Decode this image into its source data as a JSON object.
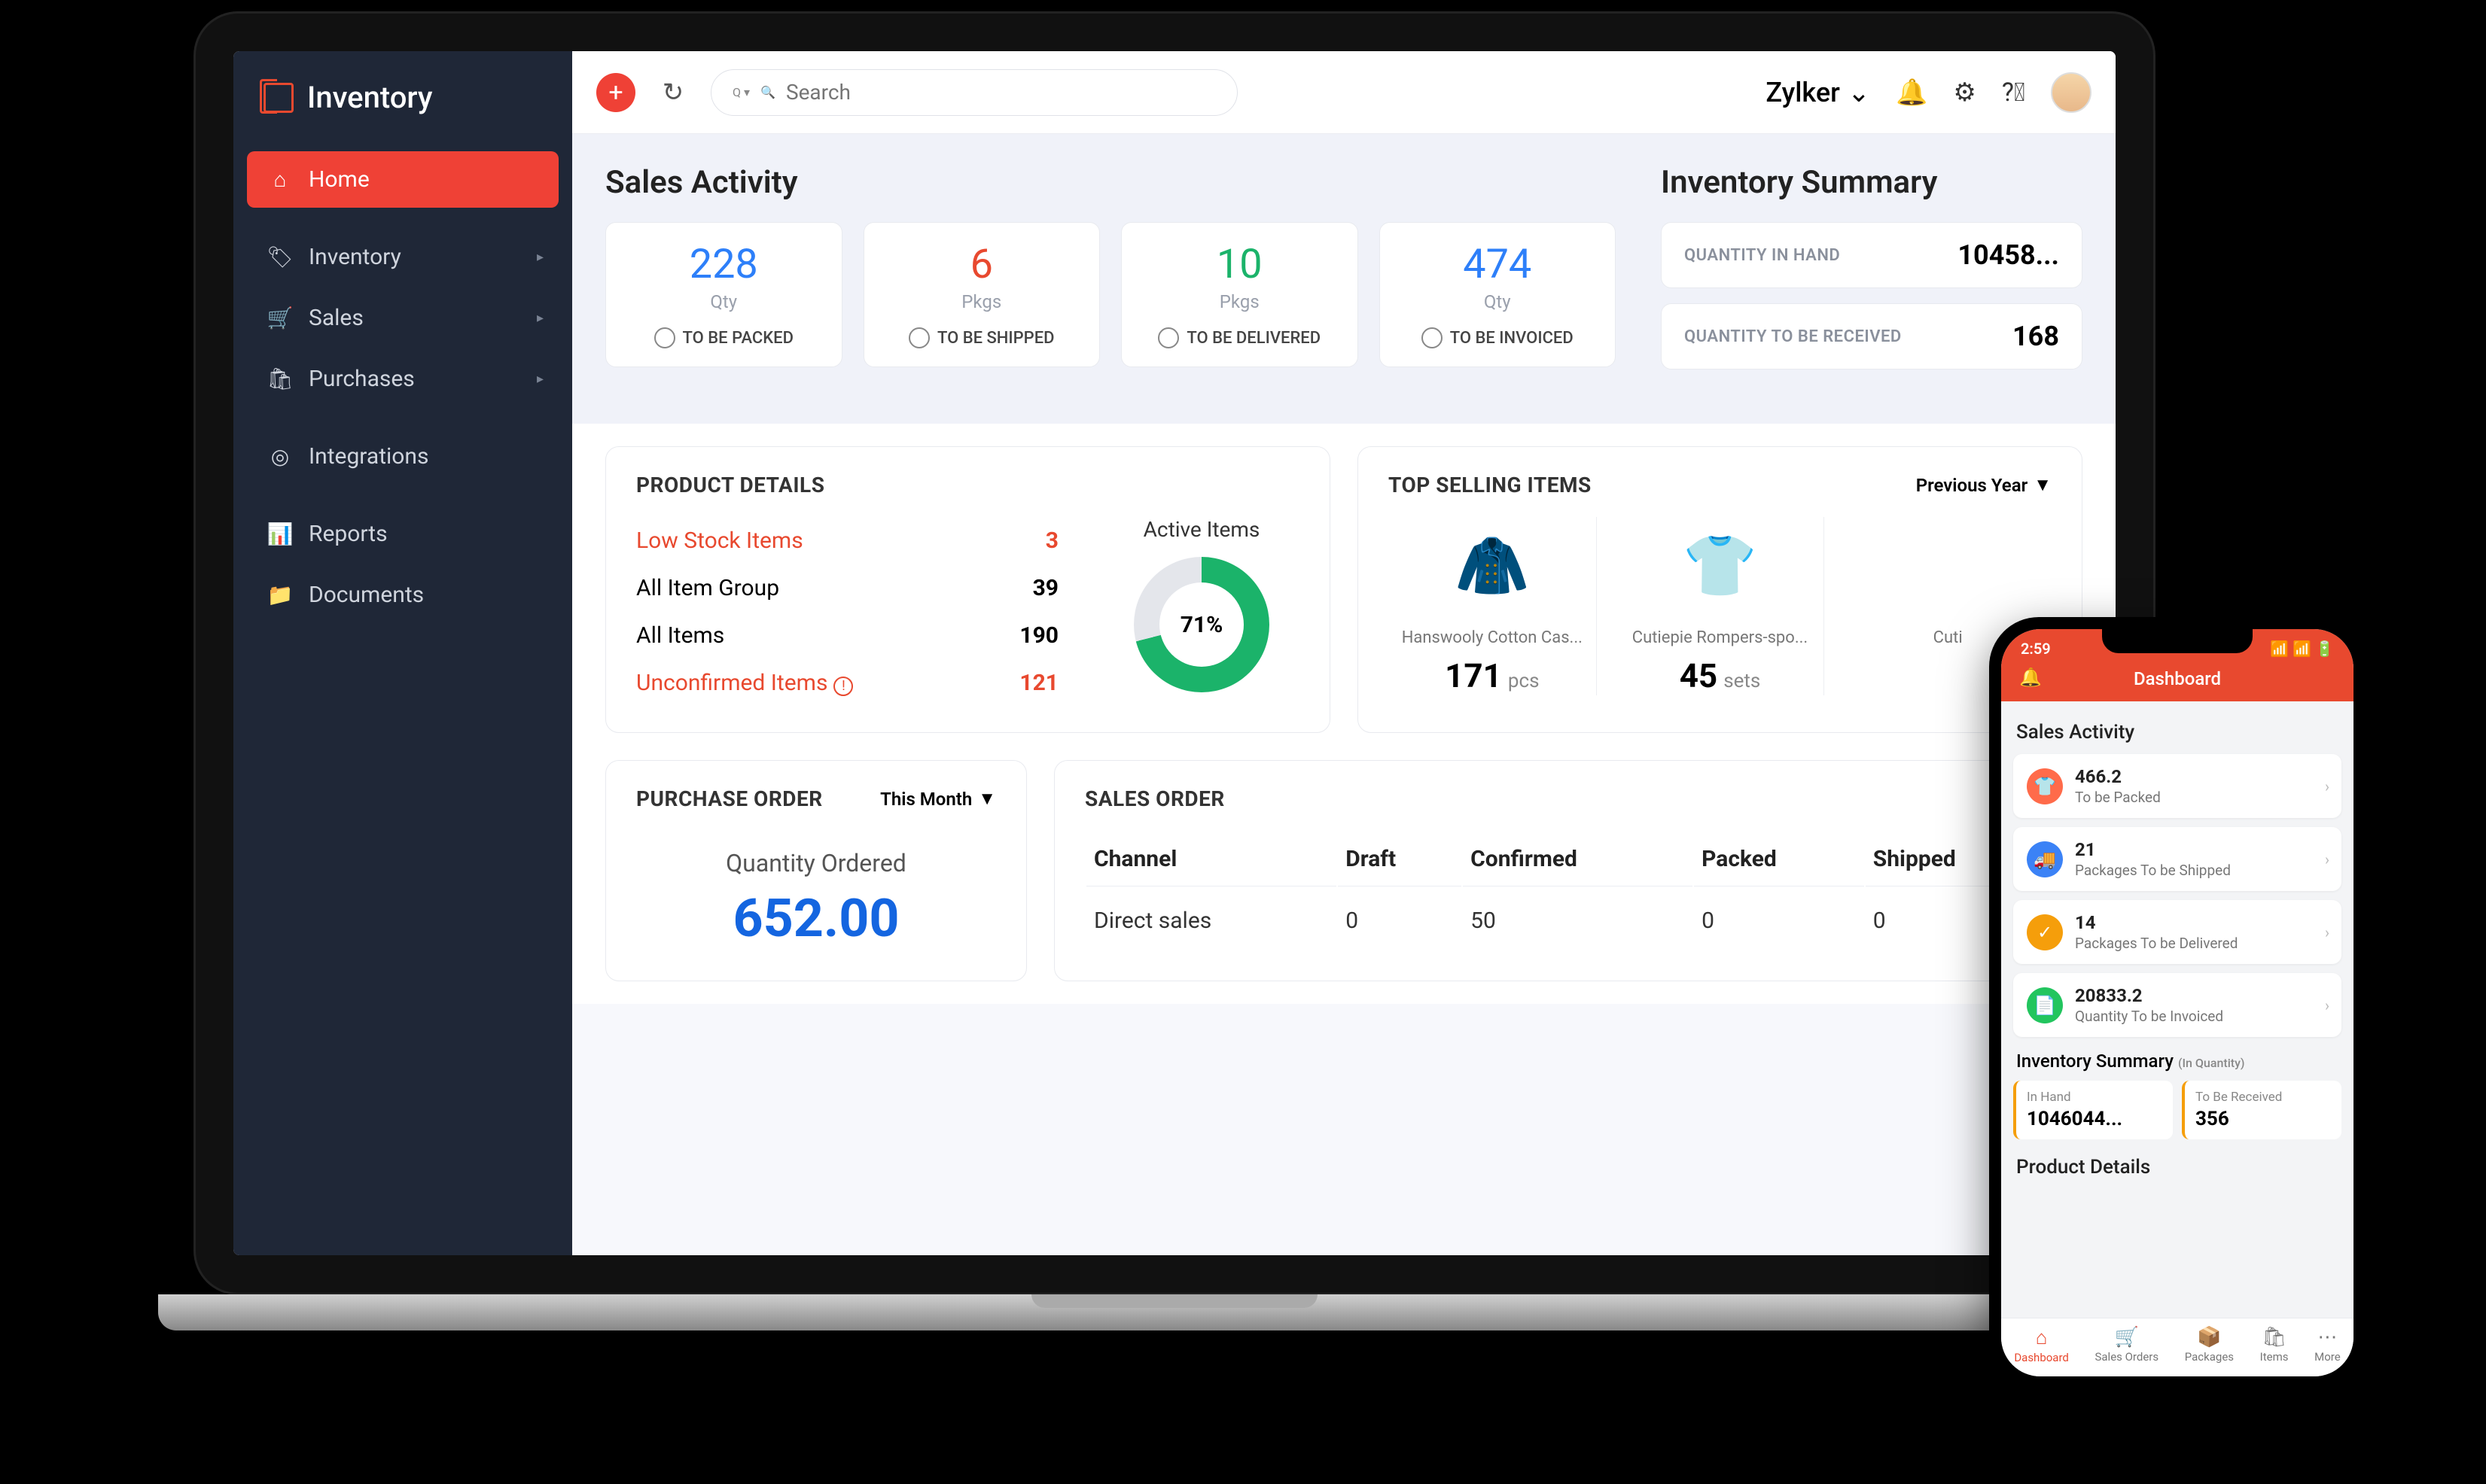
{
  "app": {
    "name": "Inventory"
  },
  "search": {
    "placeholder": "Search",
    "prefix": "Q ▾"
  },
  "org": {
    "name": "Zylker"
  },
  "sidebar": {
    "items": [
      {
        "label": "Home",
        "icon": "⌂",
        "active": true
      },
      {
        "label": "Inventory",
        "icon": "🏷",
        "submenu": true
      },
      {
        "label": "Sales",
        "icon": "🛒",
        "submenu": true
      },
      {
        "label": "Purchases",
        "icon": "🛍",
        "submenu": true
      },
      {
        "label": "Integrations",
        "icon": "◎"
      },
      {
        "label": "Reports",
        "icon": "📊"
      },
      {
        "label": "Documents",
        "icon": "📁"
      }
    ]
  },
  "salesActivity": {
    "title": "Sales Activity",
    "cards": [
      {
        "value": "228",
        "unit": "Qty",
        "status": "TO BE PACKED"
      },
      {
        "value": "6",
        "unit": "Pkgs",
        "status": "TO BE SHIPPED"
      },
      {
        "value": "10",
        "unit": "Pkgs",
        "status": "TO BE DELIVERED"
      },
      {
        "value": "474",
        "unit": "Qty",
        "status": "TO BE INVOICED"
      }
    ]
  },
  "inventorySummary": {
    "title": "Inventory Summary",
    "rows": [
      {
        "label": "QUANTITY IN HAND",
        "value": "10458..."
      },
      {
        "label": "QUANTITY TO BE RECEIVED",
        "value": "168"
      }
    ]
  },
  "productDetails": {
    "title": "PRODUCT DETAILS",
    "rows": [
      {
        "label": "Low Stock Items",
        "value": "3",
        "red": true
      },
      {
        "label": "All Item Group",
        "value": "39"
      },
      {
        "label": "All Items",
        "value": "190"
      },
      {
        "label": "Unconfirmed Items",
        "value": "121",
        "red": true,
        "warn": true
      }
    ],
    "activeLabel": "Active Items",
    "activePercent": "71%"
  },
  "topSelling": {
    "title": "TOP SELLING ITEMS",
    "period": "Previous Year",
    "items": [
      {
        "name": "Hanswooly Cotton Cas...",
        "qty": "171",
        "unit": "pcs",
        "emoji": "🧥",
        "color": "#ff7a2e"
      },
      {
        "name": "Cutiepie Rompers-spo...",
        "qty": "45",
        "unit": "sets",
        "emoji": "👕",
        "color": "#4b5fd6"
      },
      {
        "name": "Cuti",
        "qty": "",
        "unit": "",
        "emoji": "",
        "color": ""
      }
    ]
  },
  "purchaseOrder": {
    "title": "PURCHASE ORDER",
    "period": "This Month",
    "label": "Quantity Ordered",
    "value": "652.00"
  },
  "salesOrder": {
    "title": "SALES ORDER",
    "headers": [
      "Channel",
      "Draft",
      "Confirmed",
      "Packed",
      "Shipped"
    ],
    "rows": [
      {
        "cells": [
          "Direct sales",
          "0",
          "50",
          "0",
          "0"
        ]
      }
    ]
  },
  "mobile": {
    "time": "2:59",
    "title": "Dashboard",
    "salesTitle": "Sales Activity",
    "activities": [
      {
        "value": "466.2",
        "label": "To be Packed",
        "icon": "👕"
      },
      {
        "value": "21",
        "label": "Packages To be Shipped",
        "icon": "🚚"
      },
      {
        "value": "14",
        "label": "Packages To be Delivered",
        "icon": "✓"
      },
      {
        "value": "20833.2",
        "label": "Quantity To be Invoiced",
        "icon": "📄"
      }
    ],
    "invTitle": "Inventory Summary",
    "invSub": "(In Quantity)",
    "invBoxes": [
      {
        "label": "In Hand",
        "value": "1046044..."
      },
      {
        "label": "To Be Received",
        "value": "356"
      }
    ],
    "pdTitle": "Product Details",
    "tabs": [
      {
        "label": "Dashboard",
        "icon": "⌂",
        "active": true
      },
      {
        "label": "Sales Orders",
        "icon": "🛒"
      },
      {
        "label": "Packages",
        "icon": "📦"
      },
      {
        "label": "Items",
        "icon": "🛍"
      },
      {
        "label": "More",
        "icon": "⋯"
      }
    ]
  }
}
